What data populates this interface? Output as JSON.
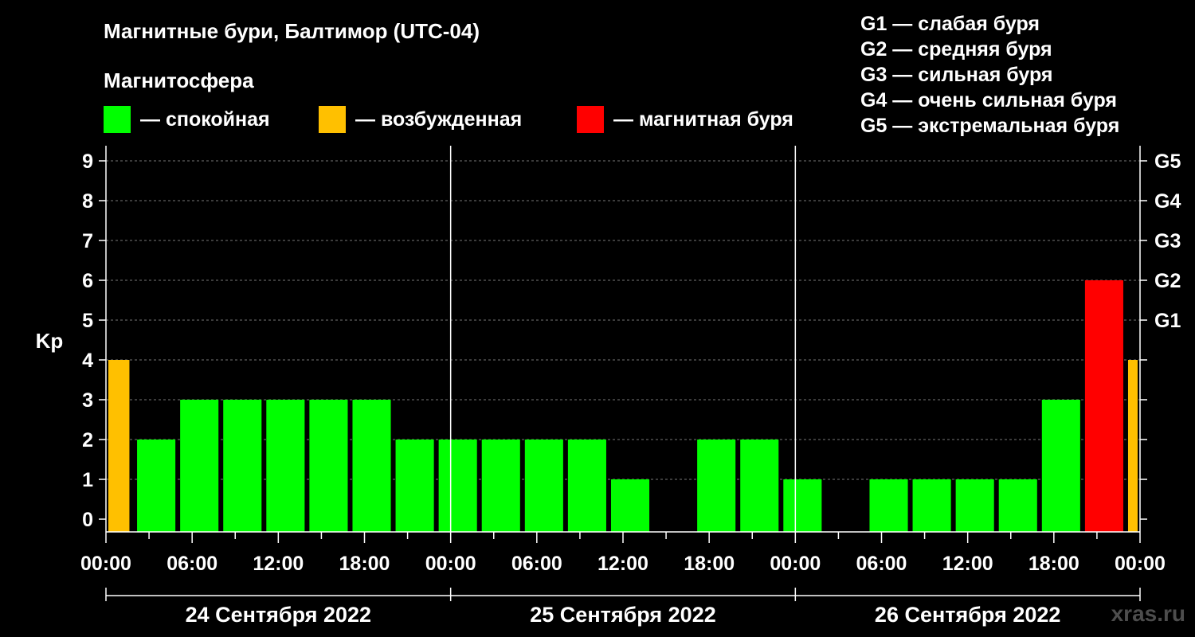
{
  "title": "Магнитные бури, Балтимор (UTC-04)",
  "subtitle": "Магнитосфера",
  "legend": [
    {
      "color": "#00ff00",
      "label": "— спокойная"
    },
    {
      "color": "#ffc000",
      "label": "— возбужденная"
    },
    {
      "color": "#ff0000",
      "label": "— магнитная буря"
    }
  ],
  "g_legend": [
    "G1 — слабая буря",
    "G2 — средняя буря",
    "G3 — сильная буря",
    "G4 — очень сильная буря",
    "G5 — экстремальная буря"
  ],
  "watermark": "xras.ru",
  "chart_data": {
    "type": "bar",
    "ylabel": "Kp",
    "ylim": [
      0,
      9
    ],
    "yticks": [
      0,
      1,
      2,
      3,
      4,
      5,
      6,
      7,
      8,
      9
    ],
    "right_axis": [
      {
        "value": 5,
        "label": "G1"
      },
      {
        "value": 6,
        "label": "G2"
      },
      {
        "value": 7,
        "label": "G3"
      },
      {
        "value": 8,
        "label": "G4"
      },
      {
        "value": 9,
        "label": "G5"
      }
    ],
    "x_range_hours": [
      0,
      72
    ],
    "x_tick_labels": [
      "00:00",
      "06:00",
      "12:00",
      "18:00",
      "00:00",
      "06:00",
      "12:00",
      "18:00",
      "00:00",
      "06:00",
      "12:00",
      "18:00",
      "00:00"
    ],
    "days": [
      "24 Сентября 2022",
      "25 Сентября 2022",
      "26 Сентября 2022"
    ],
    "grid": true,
    "bars": [
      {
        "start": 0,
        "end": 1.8,
        "kp": 4,
        "status": "возбужденная"
      },
      {
        "start": 2,
        "end": 5,
        "kp": 2,
        "status": "спокойная"
      },
      {
        "start": 5,
        "end": 8,
        "kp": 3,
        "status": "спокойная"
      },
      {
        "start": 8,
        "end": 11,
        "kp": 3,
        "status": "спокойная"
      },
      {
        "start": 11,
        "end": 14,
        "kp": 3,
        "status": "спокойная"
      },
      {
        "start": 14,
        "end": 17,
        "kp": 3,
        "status": "спокойная"
      },
      {
        "start": 17,
        "end": 20,
        "kp": 3,
        "status": "спокойная"
      },
      {
        "start": 20,
        "end": 23,
        "kp": 2,
        "status": "спокойная"
      },
      {
        "start": 23,
        "end": 26,
        "kp": 2,
        "status": "спокойная"
      },
      {
        "start": 26,
        "end": 29,
        "kp": 2,
        "status": "спокойная"
      },
      {
        "start": 29,
        "end": 32,
        "kp": 2,
        "status": "спокойная"
      },
      {
        "start": 32,
        "end": 35,
        "kp": 2,
        "status": "спокойная"
      },
      {
        "start": 35,
        "end": 38,
        "kp": 1,
        "status": "спокойная"
      },
      {
        "start": 38,
        "end": 41,
        "kp": 0,
        "status": "спокойная"
      },
      {
        "start": 41,
        "end": 44,
        "kp": 2,
        "status": "спокойная"
      },
      {
        "start": 44,
        "end": 47,
        "kp": 2,
        "status": "спокойная"
      },
      {
        "start": 47,
        "end": 50,
        "kp": 1,
        "status": "спокойная"
      },
      {
        "start": 50,
        "end": 53,
        "kp": 0,
        "status": "спокойная"
      },
      {
        "start": 53,
        "end": 56,
        "kp": 1,
        "status": "спокойная"
      },
      {
        "start": 56,
        "end": 59,
        "kp": 1,
        "status": "спокойная"
      },
      {
        "start": 59,
        "end": 62,
        "kp": 1,
        "status": "спокойная"
      },
      {
        "start": 62,
        "end": 65,
        "kp": 1,
        "status": "спокойная"
      },
      {
        "start": 65,
        "end": 68,
        "kp": 3,
        "status": "спокойная"
      },
      {
        "start": 68,
        "end": 71,
        "kp": 6,
        "status": "магнитная буря"
      },
      {
        "start": 71,
        "end": 72,
        "kp": 4,
        "status": "возбужденная"
      }
    ]
  }
}
